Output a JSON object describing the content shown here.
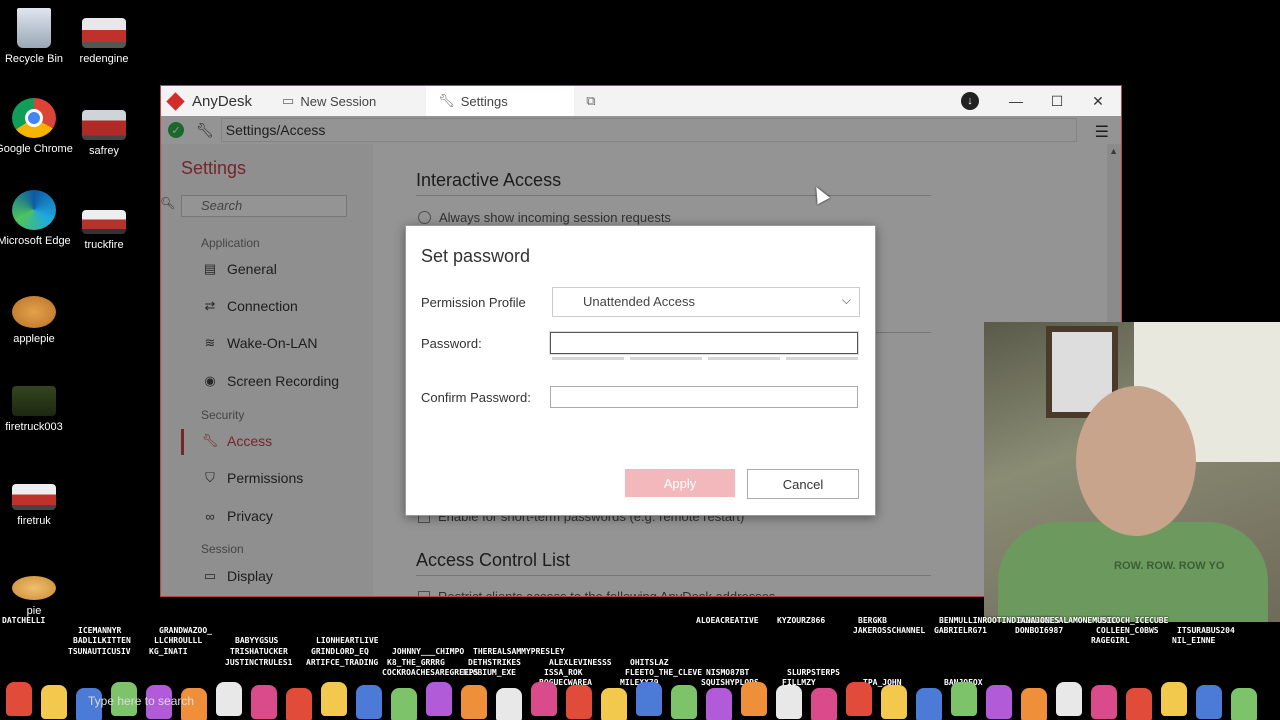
{
  "desktop": {
    "icons": [
      {
        "label": "Recycle Bin",
        "icon": "recycle-bin-icon"
      },
      {
        "label": "redengine",
        "icon": "truck-photo-icon"
      },
      {
        "label": "Google Chrome",
        "icon": "chrome-icon"
      },
      {
        "label": "safrey",
        "icon": "truck-photo-icon"
      },
      {
        "label": "Microsoft Edge",
        "icon": "edge-icon"
      },
      {
        "label": "truckfire",
        "icon": "truck-photo-icon"
      },
      {
        "label": "applepie",
        "icon": "pie-photo-icon"
      },
      {
        "label": "firetruck003",
        "icon": "truck-photo-icon"
      },
      {
        "label": "firetruk",
        "icon": "truck-photo-icon"
      },
      {
        "label": "pie",
        "icon": "pie-photo-icon"
      }
    ]
  },
  "window": {
    "brand": "AnyDesk",
    "tabs": [
      {
        "label": "New Session",
        "icon": "monitor-icon"
      },
      {
        "label": "Settings",
        "icon": "wrench-icon"
      }
    ],
    "address": "Settings/Access",
    "controls": {
      "minimize": "—",
      "maximize": "☐",
      "close": "✕"
    }
  },
  "sidebar": {
    "title": "Settings",
    "search_placeholder": "Search",
    "sections": [
      {
        "label": "Application",
        "items": [
          {
            "label": "General",
            "icon": "keyboard-icon"
          },
          {
            "label": "Connection",
            "icon": "connection-icon"
          },
          {
            "label": "Wake-On-LAN",
            "icon": "wifi-icon"
          },
          {
            "label": "Screen Recording",
            "icon": "record-icon"
          }
        ]
      },
      {
        "label": "Security",
        "items": [
          {
            "label": "Access",
            "icon": "key-icon",
            "active": true
          },
          {
            "label": "Permissions",
            "icon": "shield-icon"
          },
          {
            "label": "Privacy",
            "icon": "glasses-icon"
          }
        ]
      },
      {
        "label": "Session",
        "items": [
          {
            "label": "Display",
            "icon": "monitor-icon"
          }
        ]
      }
    ]
  },
  "main": {
    "heading1": "Interactive Access",
    "option1": "Always show incoming session requests",
    "option2": "Enable for short-term passwords (e.g. remote restart)",
    "heading2": "Access Control List",
    "option3": "Restrict clients access to the following AnyDesk addresses"
  },
  "dialog": {
    "title": "Set password",
    "permission_label": "Permission Profile",
    "permission_value": "Unattended Access",
    "password_label": "Password:",
    "password_value": "",
    "confirm_label": "Confirm Password:",
    "confirm_value": "",
    "apply_label": "Apply",
    "cancel_label": "Cancel"
  },
  "webcam": {
    "shirt_text": "ROW. ROW. ROW YO"
  },
  "chat": {
    "input_hint": "Type here to search",
    "names": [
      "DATCHELLI",
      "GRANDWAZOO_",
      "LIONHEARTLIVE",
      "THEREALSAMMYPRESLEY",
      "OHITSLAZ",
      "SLURPSTERPS",
      "BANJOFOX",
      "MOLOCH_ICECUBE",
      "ICEMANNYR",
      "BABYYGSUS",
      "JOHNNY___CHIMPO",
      "ALEXLEVINESSS",
      "NISMO87BT",
      "TPA_JOHN",
      "MICHAELSALAMONEMUSIC",
      "ITSURABUS204",
      "LLCHROULLL",
      "GRINDLORD_EQ",
      "DETHSTRIKES",
      "FLEETO_THE_CLEVE",
      "FILLMZY",
      "BENMULLINROOTINDIANAJONES",
      "COLLEEN_C0BWS",
      "BADLILKITTEN",
      "TRISHATUCKER",
      "K8_THE_GRRRG",
      "ISSA_ROK",
      "SQUISHYPLOPS",
      "BERGKB",
      "DONBOI6987",
      "NIL_EINNE",
      "KG_INATI",
      "ARTIFCE_TRADING",
      "NIOBIUM_EXE",
      "MILEXX79",
      "KYZOURZ866",
      "GABRIELRG71",
      "RAGEGIRL",
      "TSUNAUTICUSIV",
      "JUSTINCTRULES1",
      "COCKROACHESAREGREEPS",
      "ROGUECWAREA",
      "ALOEACREATIVE",
      "JAKEROSSCHANNEL"
    ]
  }
}
